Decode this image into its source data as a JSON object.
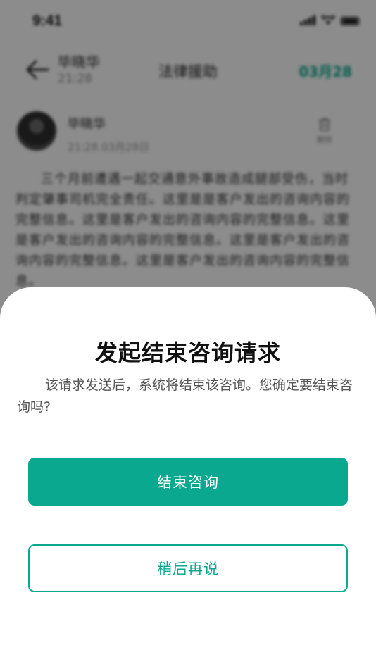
{
  "status_bar": {
    "time": "9:41"
  },
  "nav": {
    "contact_name": "毕晓华",
    "contact_time": "21:28",
    "title": "法律援助",
    "date": "03月28"
  },
  "post": {
    "author": "毕晓华",
    "timestamp": "21:28 03月28日",
    "delete_label": "删除",
    "content": "三个月前遭遇一起交通意外事故造成腿部受伤，当时判定肇事司机完全责任。这里是是客户发出的咨询内容的完整信息。这里是客户发出的咨询内容的完整信息。这里是客户发出的咨询内容的完整信息。这里是客户发出的咨询内容的完整信息。这里是客户发出的咨询内容的完整信息。"
  },
  "dialog": {
    "title": "发起结束咨询请求",
    "message": "该请求发送后，系统将结束该咨询。您确定要结束咨询吗?",
    "confirm_label": "结束咨询",
    "cancel_label": "稍后再说"
  },
  "colors": {
    "accent": "#0aa88f",
    "overlay": "rgba(0,0,0,0.45)"
  },
  "icons": {
    "back": "back-arrow-icon",
    "delete": "trash-icon",
    "signal": "signal-icon",
    "wifi": "wifi-icon",
    "battery": "battery-icon"
  }
}
